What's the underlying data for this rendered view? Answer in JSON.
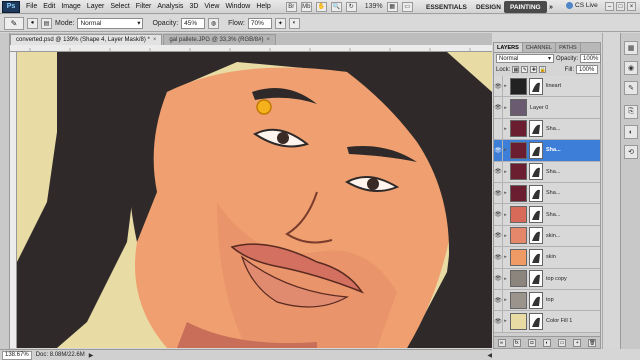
{
  "app": {
    "logo": "Ps",
    "menu": [
      "File",
      "Edit",
      "Image",
      "Layer",
      "Select",
      "Filter",
      "Analysis",
      "3D",
      "View",
      "Window",
      "Help"
    ],
    "zoom": "139%",
    "workspaces": [
      "ESSENTIALS",
      "DESIGN",
      "PAINTING"
    ],
    "active_workspace": "PAINTING",
    "cs_live": "CS Live",
    "window_controls": [
      "–",
      "□",
      "×"
    ]
  },
  "options": {
    "mode_label": "Mode:",
    "mode_value": "Normal",
    "opacity_label": "Opacity:",
    "opacity_value": "45%",
    "flow_label": "Flow:",
    "flow_value": "70%"
  },
  "tabs": [
    {
      "label": "converted.psd @ 139% (Shape 4, Layer Mask/8) *",
      "active": true
    },
    {
      "label": "gal pallete.JPG @ 33,3% (RGB/8#)",
      "active": false
    }
  ],
  "status": {
    "zoom": "138.67%",
    "doc": "Doc: 8.08M/22.6M"
  },
  "panel": {
    "tabs": [
      "LAYERS",
      "CHANNEL",
      "PATHS"
    ],
    "blend_mode": "Normal",
    "opacity_label": "Opacity:",
    "opacity_value": "100%",
    "lock_label": "Lock:",
    "fill_label": "Fill:",
    "fill_value": "100%",
    "layers": [
      {
        "name": "lineart",
        "color": "#222222",
        "has_mask": true,
        "visible": true,
        "selected": false
      },
      {
        "name": "Layer 0",
        "color": "#6b5b70",
        "has_mask": false,
        "visible": true,
        "selected": false
      },
      {
        "name": "Sha...",
        "color": "#6a1e30",
        "has_mask": true,
        "visible": false,
        "selected": false
      },
      {
        "name": "Sha...",
        "color": "#6a1e30",
        "has_mask": true,
        "visible": true,
        "selected": true
      },
      {
        "name": "Sha...",
        "color": "#6a1e30",
        "has_mask": true,
        "visible": true,
        "selected": false
      },
      {
        "name": "Sha...",
        "color": "#6a1e30",
        "has_mask": true,
        "visible": true,
        "selected": false
      },
      {
        "name": "Sha...",
        "color": "#d86a5a",
        "has_mask": true,
        "visible": true,
        "selected": false
      },
      {
        "name": "skin...",
        "color": "#e5876a",
        "has_mask": true,
        "visible": true,
        "selected": false
      },
      {
        "name": "skin",
        "color": "#f09a66",
        "has_mask": true,
        "visible": true,
        "selected": false
      },
      {
        "name": "top copy",
        "color": "#8c857e",
        "has_mask": true,
        "visible": true,
        "selected": false
      },
      {
        "name": "top",
        "color": "#9a948d",
        "has_mask": true,
        "visible": true,
        "selected": false
      },
      {
        "name": "Color Fill 1",
        "color": "#e8dba4",
        "has_mask": true,
        "visible": true,
        "selected": false
      }
    ]
  },
  "colors": {
    "background": "#e8dba4",
    "hair": "#2f2a29",
    "skin": "#f0a070",
    "accent": "#3d7fd8",
    "cursor": "#f5b21c"
  }
}
